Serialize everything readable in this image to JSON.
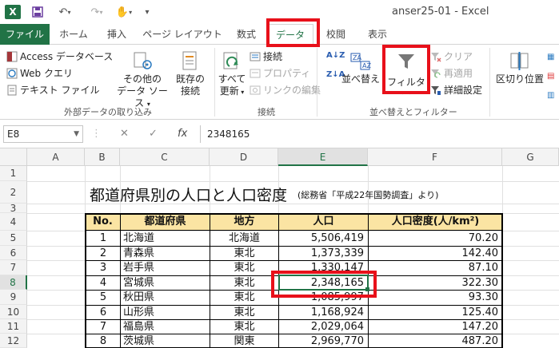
{
  "titlebar": {
    "logo": "X",
    "window_title": "anser25-01 - Excel",
    "icons": [
      "save-icon",
      "undo-icon",
      "redo-icon",
      "touch-mode-icon",
      "customize-icon"
    ]
  },
  "tabs": [
    "ファイル",
    "ホーム",
    "挿入",
    "ページ レイアウト",
    "数式",
    "データ",
    "校閲",
    "表示"
  ],
  "ribbon": {
    "access": "Access データベース",
    "web": "Web クエリ",
    "text": "テキスト ファイル",
    "other_sources_1": "その他の",
    "other_sources_2": "データ ソース",
    "existing_1": "既存の",
    "existing_2": "接続",
    "refresh_1": "すべて",
    "refresh_2": "更新",
    "connections": "接続",
    "properties": "プロパティ",
    "edit_links": "リンクの編集",
    "sort": "並べ替え",
    "filter": "フィルター",
    "clear": "クリア",
    "reapply": "再適用",
    "advanced": "詳細設定",
    "text_to_columns": "区切り位置",
    "group_external": "外部データの取り込み",
    "group_connections": "接続",
    "group_sort_filter": "並べ替えとフィルター",
    "colors": {
      "accent": "#217346",
      "highlight": "#e8101a",
      "header_fill": "#fbe4a3"
    }
  },
  "formula_bar": {
    "name_box": "E8",
    "cancel": "✕",
    "enter": "✓",
    "fx": "fx",
    "value": "2348165"
  },
  "columns": [
    "A",
    "B",
    "C",
    "D",
    "E",
    "F",
    "G"
  ],
  "rows": [
    "1",
    "2",
    "3",
    "4",
    "5",
    "6",
    "7",
    "8",
    "9",
    "10",
    "11",
    "12"
  ],
  "sheet": {
    "title": "都道府県別の人口と人口密度",
    "subtitle": "(総務省「平成22年国勢調査」より)",
    "headers": [
      "No.",
      "都道府県",
      "地方",
      "人口",
      "人口密度(人/km²)"
    ],
    "data": [
      [
        "1",
        "北海道",
        "北海道",
        "5,506,419",
        "70.20"
      ],
      [
        "2",
        "青森県",
        "東北",
        "1,373,339",
        "142.40"
      ],
      [
        "3",
        "岩手県",
        "東北",
        "1,330,147",
        "87.10"
      ],
      [
        "4",
        "宮城県",
        "東北",
        "2,348,165",
        "322.30"
      ],
      [
        "5",
        "秋田県",
        "東北",
        "1,085,997",
        "93.30"
      ],
      [
        "6",
        "山形県",
        "東北",
        "1,168,924",
        "125.40"
      ],
      [
        "7",
        "福島県",
        "東北",
        "2,029,064",
        "147.20"
      ],
      [
        "8",
        "茨城県",
        "関東",
        "2,969,770",
        "487.20"
      ]
    ]
  }
}
